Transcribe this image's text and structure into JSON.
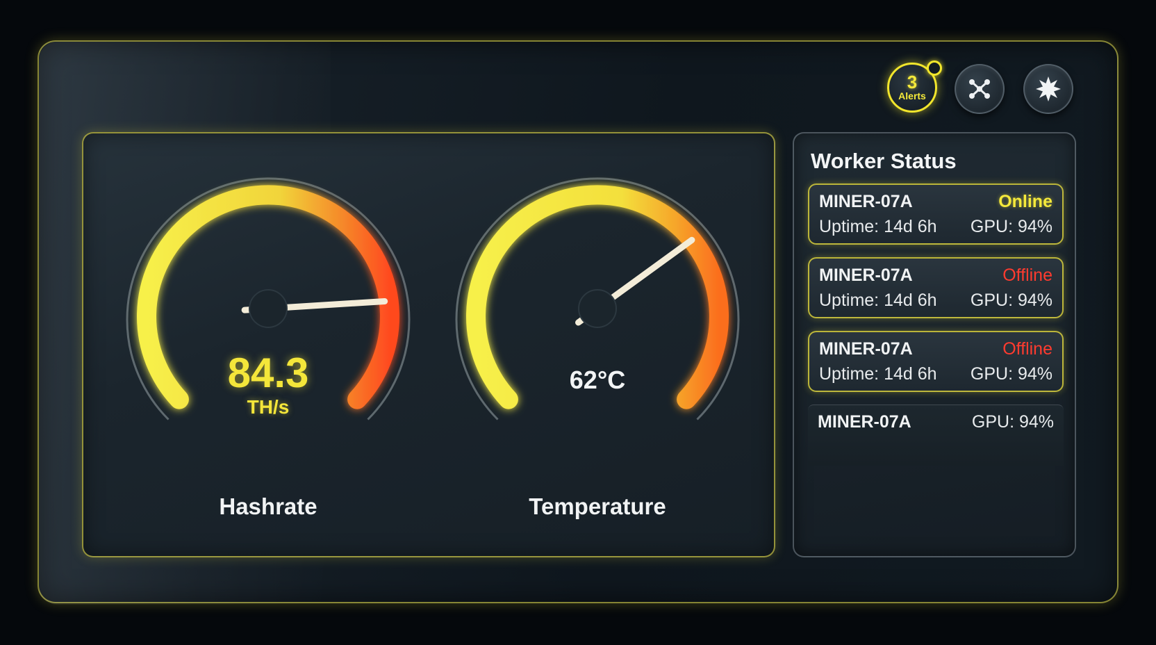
{
  "header": {
    "alerts": {
      "count": "3",
      "label": "Alerts"
    },
    "buttons": [
      {
        "icon": "network-nodes-icon"
      },
      {
        "icon": "starburst-icon"
      }
    ]
  },
  "gauges": {
    "hashrate": {
      "value": "84.3",
      "unit": "TH/s",
      "label": "Hashrate",
      "needle_fraction": 0.82
    },
    "temperature": {
      "value": "62°C",
      "label": "Temperature",
      "needle_fraction": 0.7
    }
  },
  "colors": {
    "accent": "#f2e62c",
    "gauge_hot": "#ff4a1f",
    "offline": "#ff3b2f",
    "online": "#f5e93b"
  },
  "worker_status": {
    "title": "Worker Status",
    "workers": [
      {
        "name": "MINER-07A",
        "status": "Online",
        "uptime": "Uptime: 14d 6h",
        "gpu": "GPU: 94%"
      },
      {
        "name": "MINER-07A",
        "status": "Offline",
        "uptime": "Uptime: 14d 6h",
        "gpu": "GPU: 94%"
      },
      {
        "name": "MINER-07A",
        "status": "Offline",
        "uptime": "Uptime: 14d 6h",
        "gpu": "GPU: 94%"
      },
      {
        "name": "MINER-07A",
        "gpu": "GPU: 94%"
      }
    ]
  }
}
